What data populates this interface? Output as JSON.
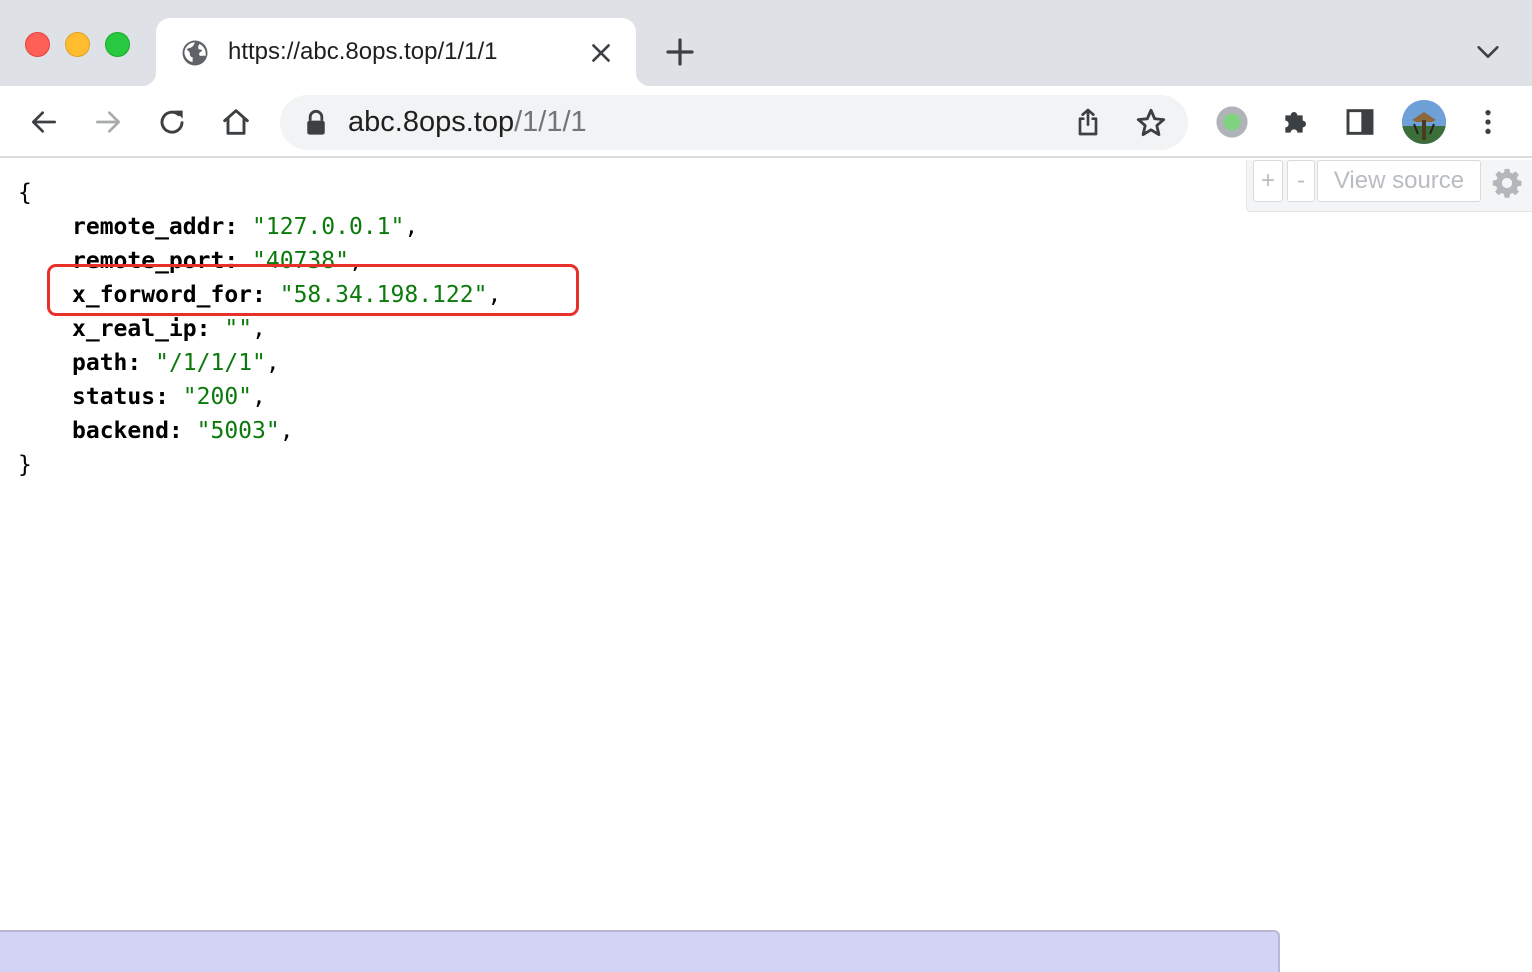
{
  "tab": {
    "title": "https://abc.8ops.top/1/1/1",
    "icon": "globe-icon"
  },
  "omnibox": {
    "host": "abc.8ops.top",
    "path": "/1/1/1"
  },
  "viewer": {
    "plus_label": "+",
    "minus_label": "-",
    "view_source_label": "View source"
  },
  "json": {
    "open_brace": "{",
    "close_brace": "}",
    "rows": [
      {
        "key": "remote_addr:",
        "value": "\"127.0.0.1\"",
        "comma": ","
      },
      {
        "key": "remote_port:",
        "value": "\"40738\"",
        "comma": ","
      },
      {
        "key": "x_forword_for:",
        "value": "\"58.34.198.122\"",
        "comma": ","
      },
      {
        "key": "x_real_ip:",
        "value": "\"\"",
        "comma": ","
      },
      {
        "key": "path:",
        "value": "\"/1/1/1\"",
        "comma": ","
      },
      {
        "key": "status:",
        "value": "\"200\"",
        "comma": ","
      },
      {
        "key": "backend:",
        "value": "\"5003\"",
        "comma": ","
      }
    ],
    "highlighted_key": "x_forword_for:"
  },
  "colors": {
    "tabstrip": "#dee1e6",
    "string": "#0b7a0b",
    "highlight_border": "#e8302a",
    "statusbar": "#d3d3f5"
  }
}
